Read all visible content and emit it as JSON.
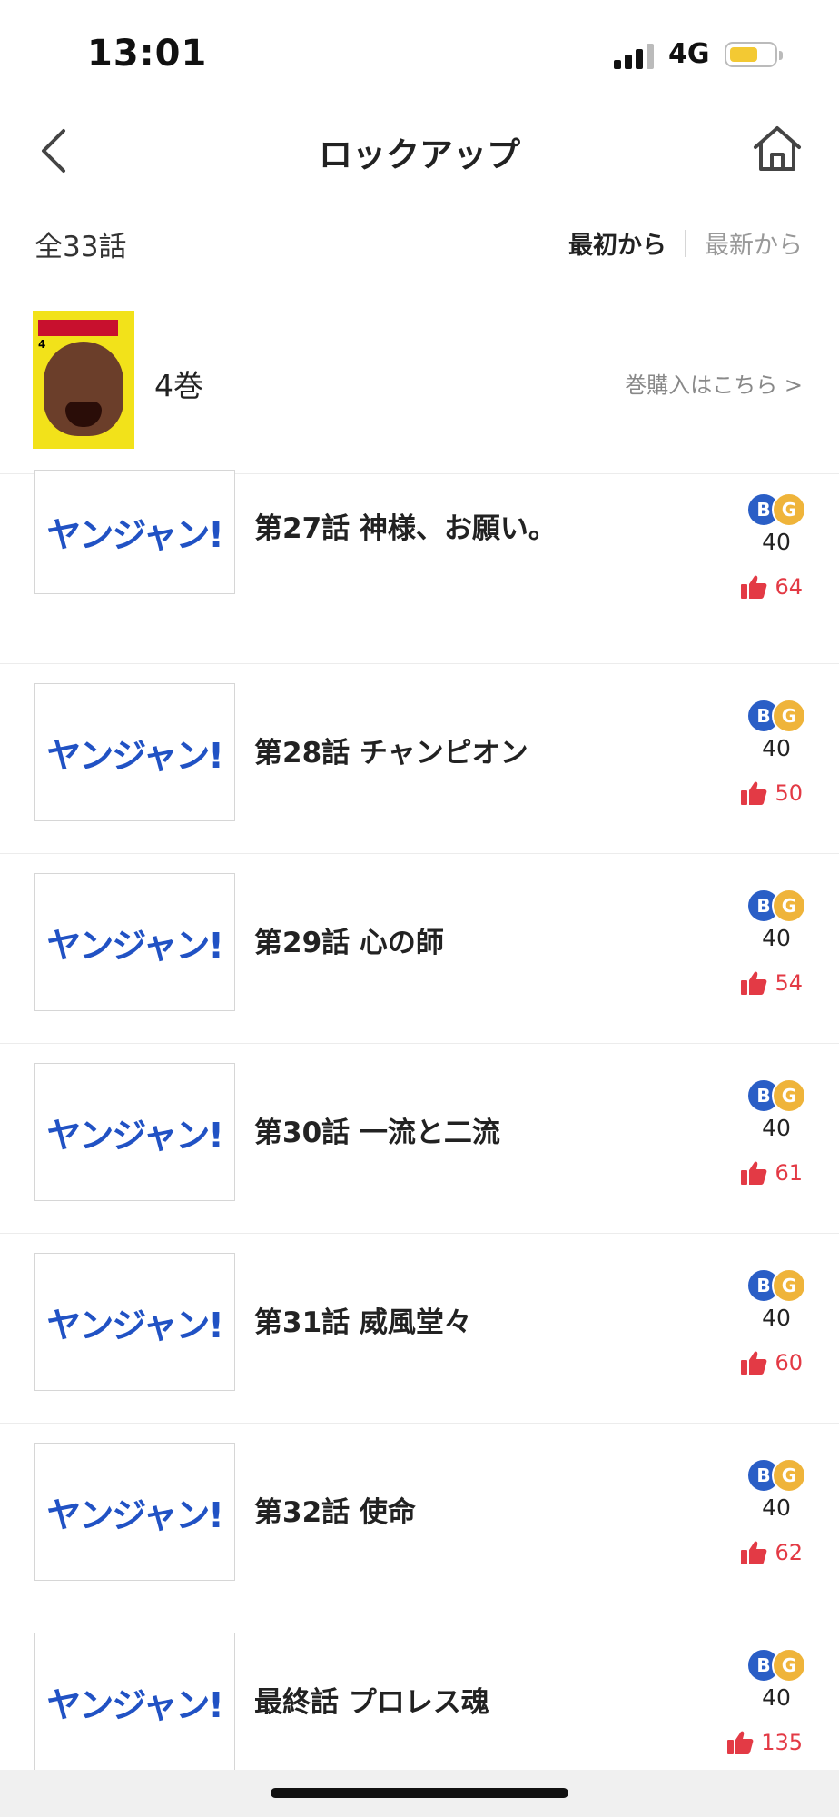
{
  "status_bar": {
    "time": "13:01",
    "network": "4G"
  },
  "nav": {
    "title": "ロックアップ"
  },
  "summary": {
    "total": "全33話",
    "sort_first": "最初から",
    "sort_latest": "最新から"
  },
  "volume": {
    "label": "4巻",
    "buy_link": "巻購入はこちら >",
    "cover_number": "4"
  },
  "episodes": [
    {
      "title": "第27話 神様、お願い。",
      "coin_b": "B",
      "coin_g": "G",
      "price": "40",
      "likes": "64"
    },
    {
      "title": "第28話 チャンピオン",
      "coin_b": "B",
      "coin_g": "G",
      "price": "40",
      "likes": "50"
    },
    {
      "title": "第29話 心の師",
      "coin_b": "B",
      "coin_g": "G",
      "price": "40",
      "likes": "54"
    },
    {
      "title": "第30話 一流と二流",
      "coin_b": "B",
      "coin_g": "G",
      "price": "40",
      "likes": "61"
    },
    {
      "title": "第31話 威風堂々",
      "coin_b": "B",
      "coin_g": "G",
      "price": "40",
      "likes": "60"
    },
    {
      "title": "第32話 使命",
      "coin_b": "B",
      "coin_g": "G",
      "price": "40",
      "likes": "62"
    },
    {
      "title": "最終話 プロレス魂",
      "coin_b": "B",
      "coin_g": "G",
      "price": "40",
      "likes": "135"
    }
  ],
  "thumbnail_logo": "ヤンジャン!",
  "colors": {
    "accent_blue": "#2152c4",
    "like_red": "#e33a45",
    "coin_gold": "#efb43a",
    "coin_blue": "#2a5ec6"
  }
}
